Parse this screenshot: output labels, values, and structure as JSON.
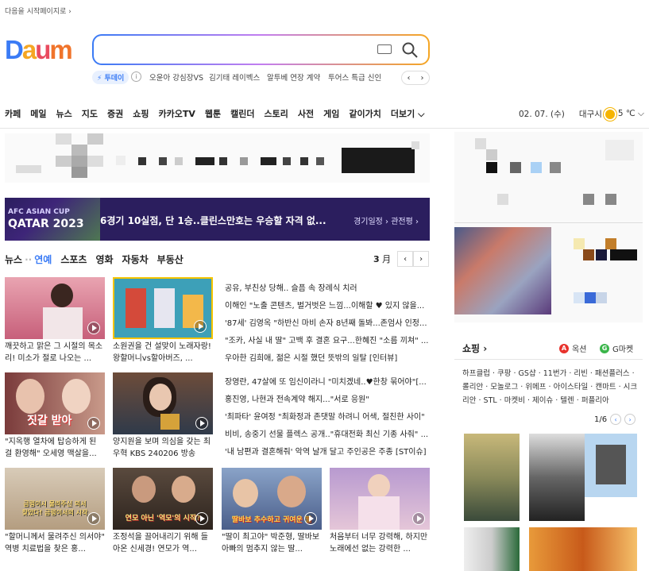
{
  "top": {
    "set_homepage": "다음을 시작페이지로 ›"
  },
  "logo": {
    "d": "D",
    "a": "a",
    "u": "u",
    "m": "m"
  },
  "search": {
    "value": "",
    "placeholder": ""
  },
  "trending": {
    "badge": "⚡ 투데이",
    "info": "i",
    "items": [
      "오윤아 강심장VS",
      "김기태 레이벡스",
      "알투베 연장 계약",
      "투어스 특급 신인"
    ],
    "prev": "‹",
    "next": "›"
  },
  "nav": {
    "items": [
      "카페",
      "메일",
      "뉴스",
      "지도",
      "증권",
      "쇼핑",
      "카카오TV",
      "웹툰",
      "캘린더",
      "스토리",
      "사전",
      "게임",
      "같이가치",
      "더보기 ⌵"
    ],
    "date": "02. 07. (수)",
    "city": "대구시",
    "temp": "5 ℃ ⌵"
  },
  "banner": {
    "afc": "AFC ASIAN CUP",
    "qatar": "QATAR 2023",
    "message": "6경기 10실점, 단 1승..클린스만호는 우승할 자격 없...",
    "links": "경기일정 ›  관전평 ›"
  },
  "news": {
    "tabs": [
      "뉴스",
      "연예",
      "스포츠",
      "영화",
      "자동차",
      "부동산"
    ],
    "page": "3",
    "page_suffix": "月",
    "prev": "‹",
    "next": "›",
    "thumb_captions": [
      "깨끗하고 맑은 그 시절의 목소리! 미소가 절로 나오는 ...",
      "소원권을 건 설맞이 노래자랑! 왕할머니vs할아버즈, ...",
      "\"지옥행 열차에 탑승하게 된 걸 환영해\" 오세영 맥살을...",
      "양지원을 보며 의심을 갖는 최우혁 KBS 240206 방송",
      "\"할머니께서 물려주신 의서야\" 역병 치료법을 찾은 홍...",
      "조정석을 끌어내리기 위해 들아온 신세경! 연모가 역...",
      "\"딸이 최고야\" 박준형, 딸바보 아빠의 멈추지 않는 딸...",
      "처음부터 너무 강력해, 하지만 노래에선 없는 강력한 ..."
    ],
    "thumb_overlay_3": "짓갈 받아",
    "thumb_overlay_5": "금렁이시 물려주신 의서\n찾았다! 금렁이서의 시작",
    "thumb_overlay_6": "연모 아닌 '역모'의 시작?",
    "thumb_overlay_7": "딸바보 추수하고 귀여운 딸",
    "headlines": [
      "공유, 부친상 당해.. 슬픔 속 장례식 치러",
      "이해인 \"노출 콘텐츠, 벌거벗은 느낌...이해할 ♥ 있지 않을...",
      "'87세' 김영옥 \"하반신 마비 손자 8년째 돌봐...존엄사 인정...",
      "\"조카, 사실 내 딸\" 고백 후 결혼 요구...한혜진 \"소름 끼쳐\" ...",
      "우아한 김희애, 젊은 시절 했던 뜻밖의 일탈 [인터뷰]",
      "장영란, 47살에 또 임신이라니 \"미치겠네..♥한창 묶어야\"[...",
      "홍진영, 나현과 전속계약 해지...\"서로 응원\"",
      "'최파타' 윤여정 \"최화정과 존댓말 하려니 어색, 절친한 사이\"",
      "비비, 송중기 선물 플렉스 공개..\"휴대전화 최신 기종 사줘\" ...",
      "'내 남편과 결혼해줘' 악역 날개 달고 주인공은 주종 [ST이슈]"
    ]
  },
  "shopping": {
    "title": "쇼핑 ›",
    "auction_logo": "A",
    "auction": "옥션",
    "gmarket_logo": "G",
    "gmarket": "G마켓",
    "links": "하프클럽 · 쿠팡 · GS샵 · 11번가 · 리빈 · 패션플러스 · 롤리안 · 모놀로그 · 위메프 · 아이스타일 · 캔마트 · 시크리안 · STL · 마켓비 · 제이슈 · 텔렌 · 퍼플리아",
    "page": "1/6",
    "prev": "‹",
    "next": "›"
  },
  "colors": {
    "accent": "#3a7bf5",
    "banner_bg": "#2b1e5e",
    "auction": "#e8322c",
    "gmarket": "#3ab54a"
  }
}
